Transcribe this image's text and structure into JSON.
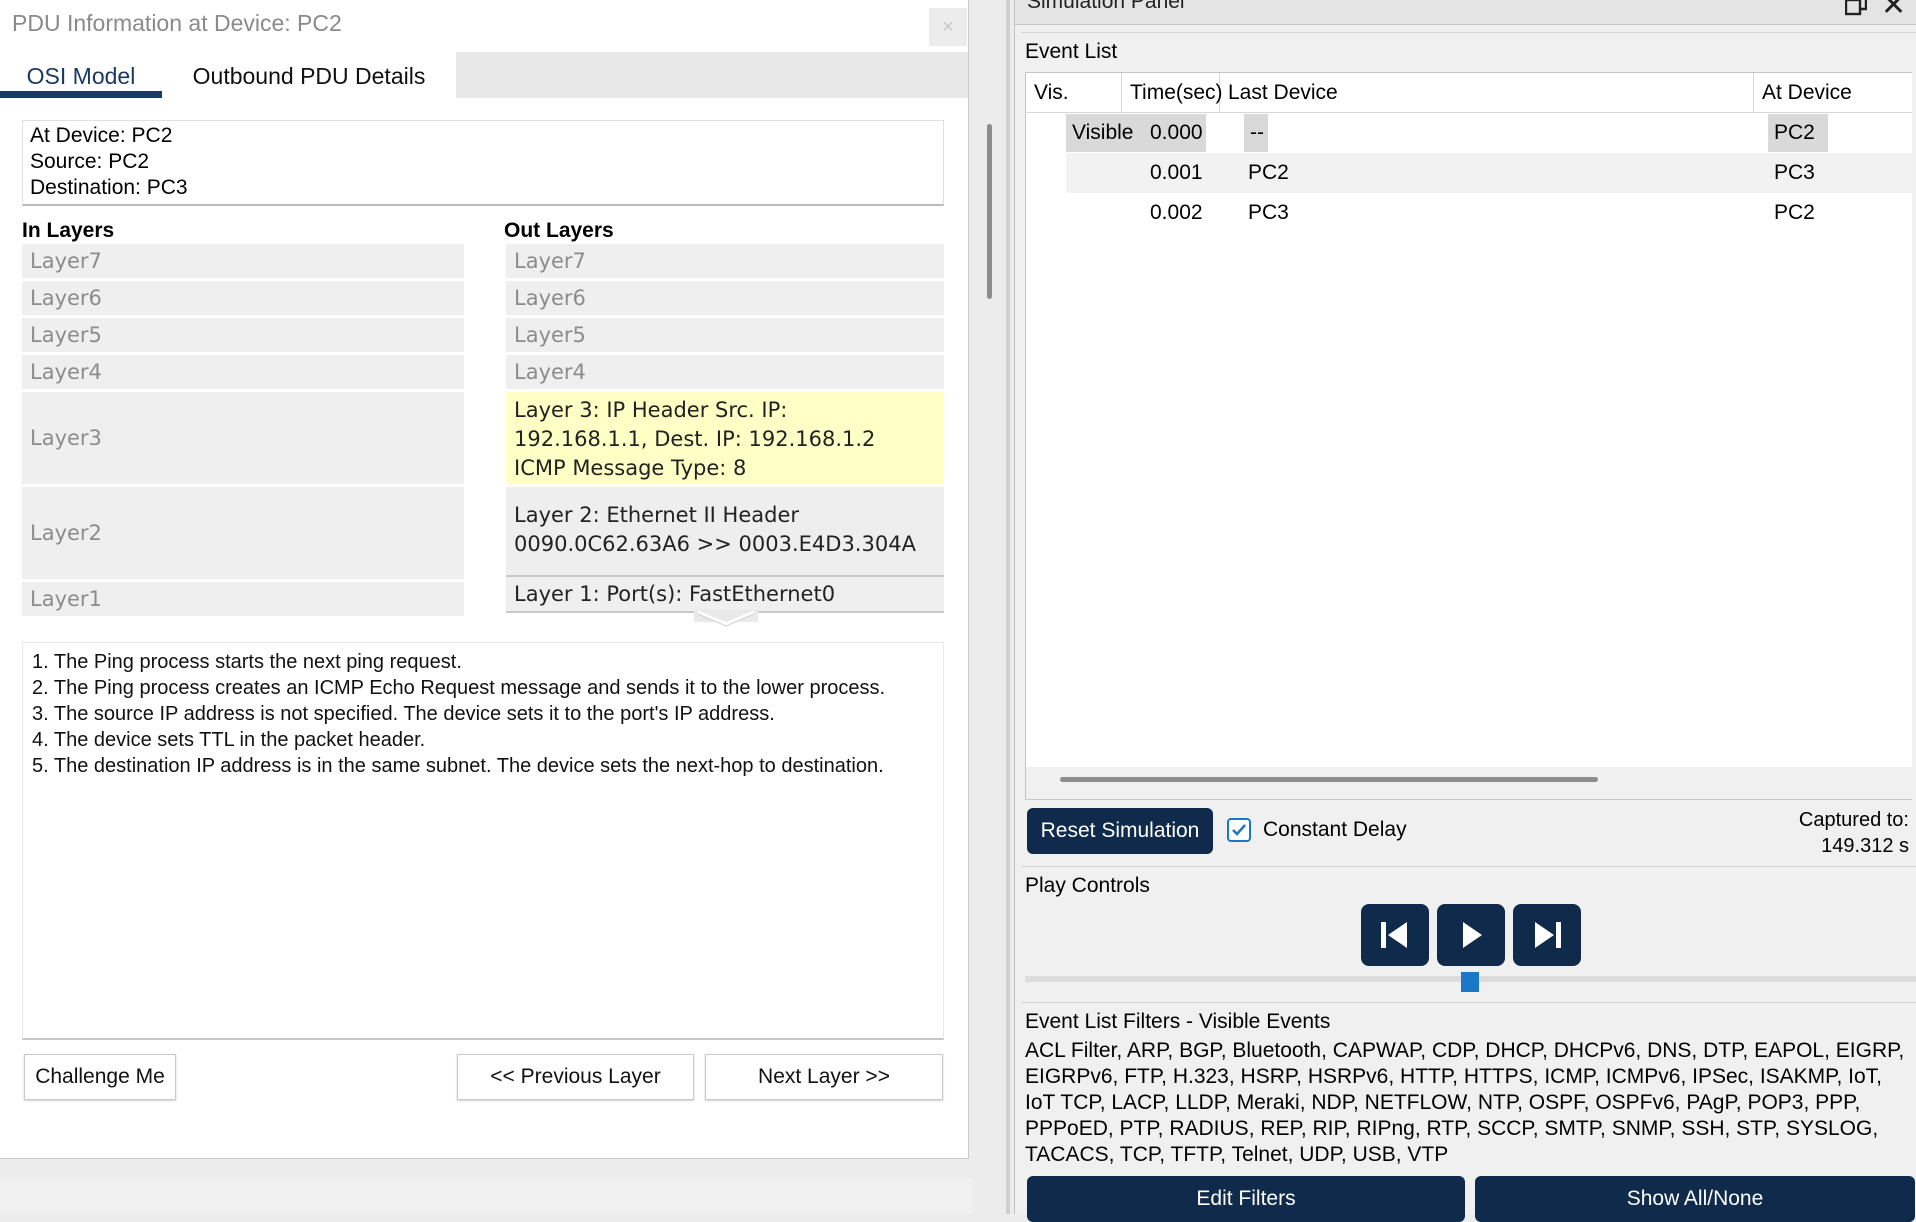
{
  "pdu_window": {
    "title": "PDU Information at Device: PC2",
    "close_glyph": "×",
    "tabs": [
      "OSI Model",
      "Outbound PDU Details"
    ],
    "info": {
      "at_device": "At Device: PC2",
      "source": "Source: PC2",
      "destination": "Destination: PC3"
    },
    "in_layers_heading": "In Layers",
    "out_layers_heading": "Out Layers",
    "in_layers": [
      "Layer7",
      "Layer6",
      "Layer5",
      "Layer4",
      "Layer3",
      "Layer2",
      "Layer1"
    ],
    "out_layers": [
      "Layer7",
      "Layer6",
      "Layer5",
      "Layer4",
      [
        "Layer 3: IP Header Src. IP:",
        "192.168.1.1, Dest. IP: 192.168.1.2",
        "ICMP Message Type: 8"
      ],
      [
        "Layer 2: Ethernet II Header",
        "0090.0C62.63A6 >> 0003.E4D3.304A"
      ],
      "Layer 1: Port(s): FastEthernet0"
    ],
    "description": [
      "1. The Ping process starts the next ping request.",
      "2. The Ping process creates an ICMP Echo Request message and sends it to the lower process.",
      "3. The source IP address is not specified. The device sets it to the port's IP address.",
      "4. The device sets TTL in the packet header.",
      "5. The destination IP address is in the same subnet. The device sets the next-hop to destination."
    ],
    "buttons": {
      "challenge": "Challenge Me",
      "previous": "<< Previous Layer",
      "next": "Next Layer >>"
    }
  },
  "simulation_panel": {
    "title": "Simulation Panel",
    "event_list_label": "Event List",
    "columns": [
      "Vis.",
      "Time(sec)",
      "Last Device",
      "At Device"
    ],
    "events": [
      {
        "vis": "Visible",
        "time": "0.000",
        "last": "--",
        "at": "PC2"
      },
      {
        "vis": "",
        "time": "0.001",
        "last": "PC2",
        "at": "PC3"
      },
      {
        "vis": "",
        "time": "0.002",
        "last": "PC3",
        "at": "PC2"
      }
    ],
    "reset_button": "Reset Simulation",
    "constant_delay_label": "Constant Delay",
    "constant_delay_checked": true,
    "captured_label": "Captured to:",
    "captured_value": "149.312 s",
    "play_controls_label": "Play Controls",
    "play_buttons": [
      "back-icon",
      "play-icon",
      "forward-icon"
    ],
    "filters_label": "Event List Filters - Visible Events",
    "filters_text": "ACL Filter, ARP, BGP, Bluetooth, CAPWAP, CDP, DHCP, DHCPv6, DNS, DTP, EAPOL, EIGRP, EIGRPv6, FTP, H.323, HSRP, HSRPv6, HTTP, HTTPS, ICMP, ICMPv6, IPSec, ISAKMP, IoT, IoT TCP, LACP, LLDP, Meraki, NDP, NETFLOW, NTP, OSPF, OSPFv6, PAgP, POP3, PPP, PPPoED, PTP, RADIUS, REP, RIP, RIPng, RTP, SCCP, SMTP, SNMP, SSH, STP, SYSLOG, TACACS, TCP, TFTP, Telnet, UDP, USB, VTP",
    "edit_filters_button": "Edit Filters",
    "show_all_button": "Show All/None"
  },
  "colors": {
    "navy": "#0f2a4a",
    "highlight_yellow": "#ffffc6",
    "accent_blue": "#1d77c9"
  }
}
